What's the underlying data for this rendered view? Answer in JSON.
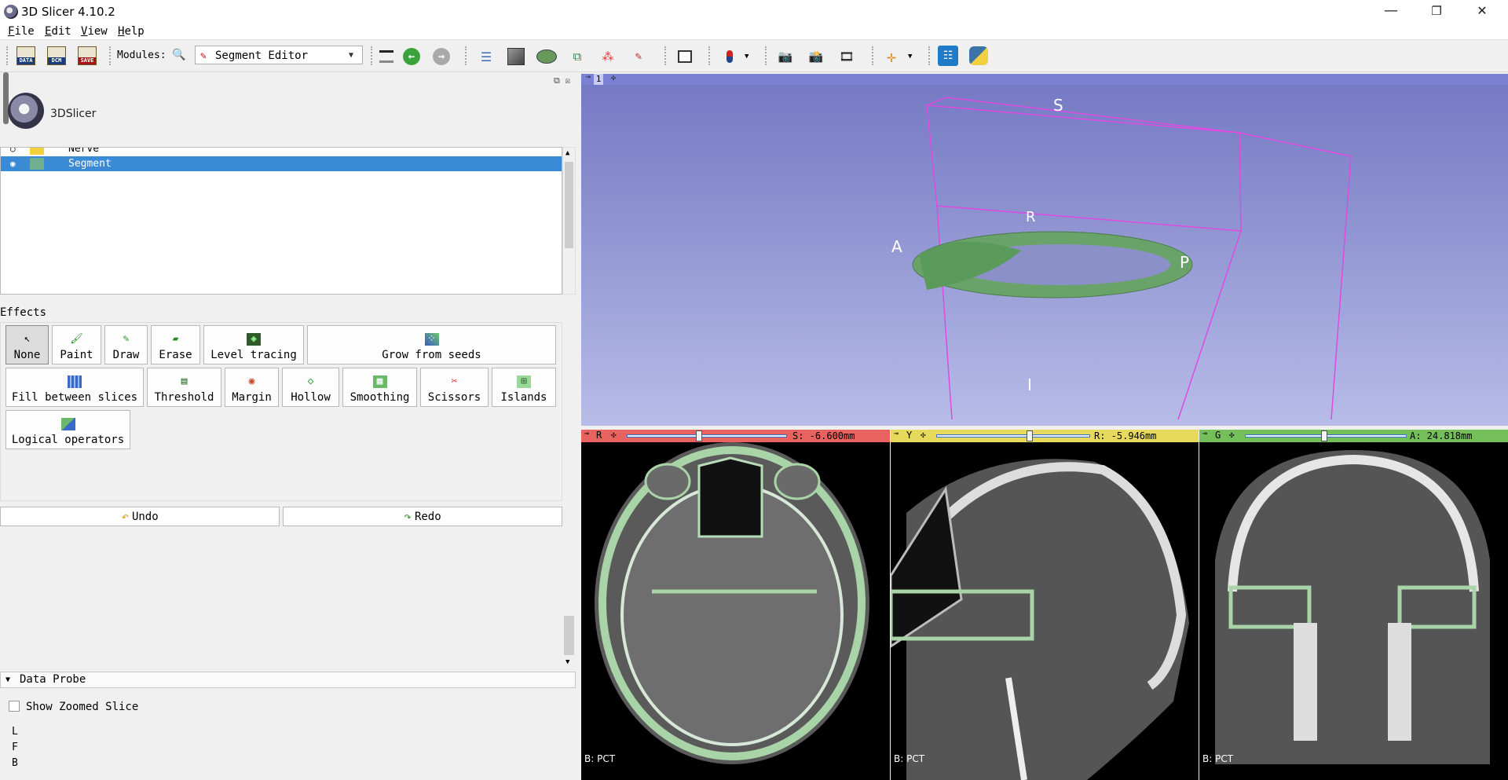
{
  "window": {
    "title": "3D Slicer 4.10.2",
    "minimize": "—",
    "restore": "❐",
    "close": "✕"
  },
  "menu": [
    "File",
    "Edit",
    "View",
    "Help"
  ],
  "toolbar": {
    "data_label": "DATA",
    "dcm_label": "DCM",
    "save_label": "SAVE",
    "modules_label": "Modules:",
    "module_selected": "Segment Editor"
  },
  "logo": {
    "text": "3DSlicer"
  },
  "segments": [
    {
      "name": "Nerve",
      "color": "#f2d13a",
      "selected": false
    },
    {
      "name": "Segment",
      "color": "#6faf8f",
      "selected": true
    }
  ],
  "effects": {
    "label": "Effects",
    "items": [
      "None",
      "Paint",
      "Draw",
      "Erase",
      "Level tracing",
      "Grow from seeds",
      "Fill between slices",
      "Threshold",
      "Margin",
      "Hollow",
      "Smoothing",
      "Scissors",
      "Islands",
      "Logical operators"
    ],
    "selected": "None"
  },
  "undo_label": "Undo",
  "redo_label": "Redo",
  "data_probe": {
    "title": "Data Probe",
    "show_zoomed": "Show Zoomed Slice",
    "rows": [
      "L",
      "F",
      "B"
    ]
  },
  "view3d": {
    "number": "1",
    "labels": {
      "S": "S",
      "R": "R",
      "A": "A",
      "P": "P",
      "I": "I"
    }
  },
  "slices": [
    {
      "letter": "R",
      "readout": "S: -6.600mm",
      "bar_color": "#e8635f",
      "layer": "B: PCT",
      "slider": 0.45
    },
    {
      "letter": "Y",
      "readout": "R: -5.946mm",
      "bar_color": "#e6d95c",
      "layer": "B: PCT",
      "slider": 0.62
    },
    {
      "letter": "G",
      "readout": "A: 24.818mm",
      "bar_color": "#74bf5a",
      "layer": "B: PCT",
      "slider": 0.5
    }
  ]
}
